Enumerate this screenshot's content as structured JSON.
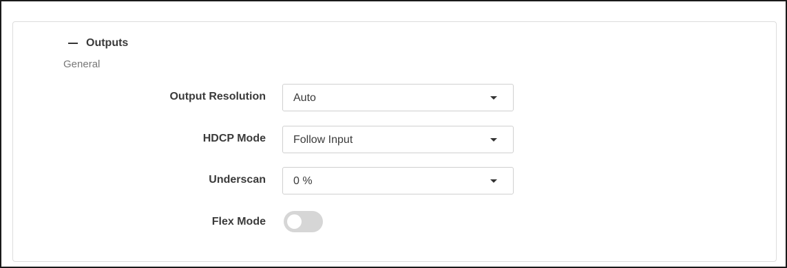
{
  "section": {
    "title": "Outputs",
    "collapse_icon": "minus-icon"
  },
  "group": {
    "label": "General"
  },
  "fields": {
    "output_resolution": {
      "label": "Output Resolution",
      "value": "Auto"
    },
    "hdcp_mode": {
      "label": "HDCP Mode",
      "value": "Follow Input"
    },
    "underscan": {
      "label": "Underscan",
      "value": "0 %"
    },
    "flex_mode": {
      "label": "Flex Mode",
      "enabled": false
    }
  },
  "colors": {
    "toggle_off": "#d6d6d6",
    "border": "#dcdcdc",
    "text": "#3a3a3a",
    "muted_text": "#777777"
  }
}
